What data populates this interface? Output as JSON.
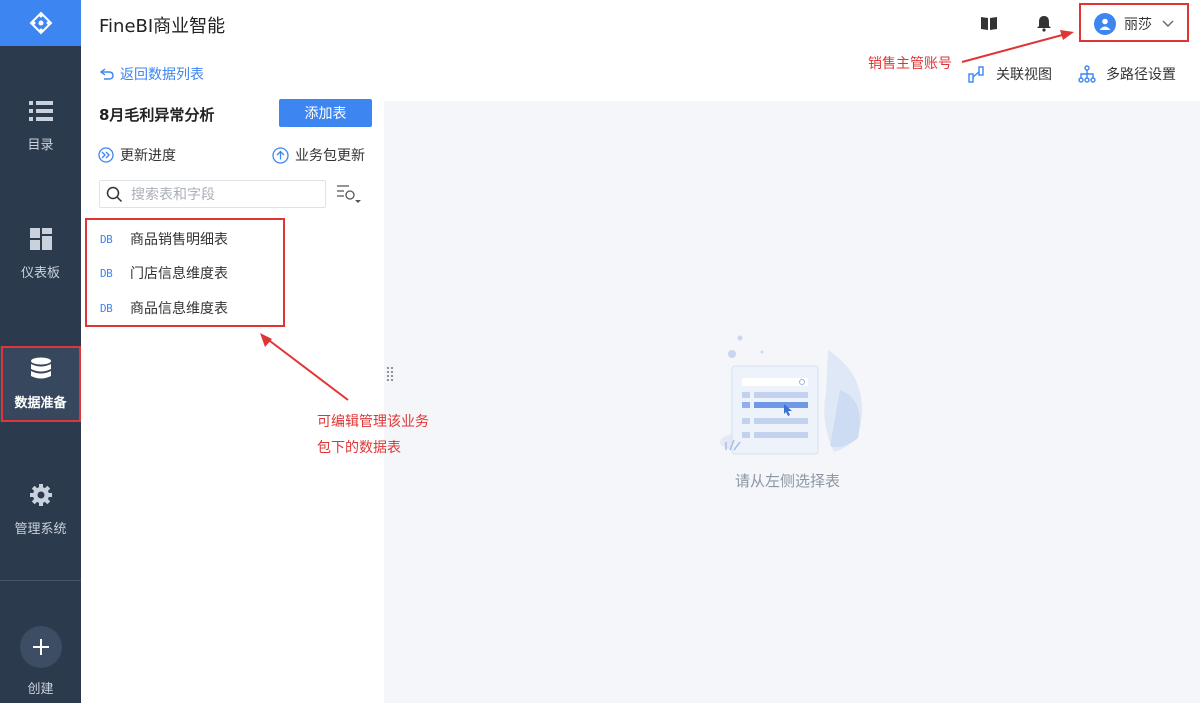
{
  "app": {
    "title": "FineBI商业智能"
  },
  "nav": {
    "items": [
      {
        "label": "目录",
        "icon": "list-icon"
      },
      {
        "label": "仪表板",
        "icon": "dashboard-icon"
      },
      {
        "label": "数据准备",
        "icon": "database-icon",
        "active": true
      },
      {
        "label": "管理系统",
        "icon": "gear-icon"
      },
      {
        "label": "创建",
        "icon": "plus-icon"
      }
    ]
  },
  "header": {
    "user_name": "丽莎"
  },
  "toolbar": {
    "relation_view": "关联视图",
    "multi_path": "多路径设置"
  },
  "panel": {
    "back_label": "返回数据列表",
    "package_name": "8月毛利异常分析",
    "add_table_label": "添加表",
    "update_progress": "更新进度",
    "package_update": "业务包更新",
    "search_placeholder": "搜索表和字段",
    "tables": [
      {
        "badge": "DB",
        "name": "商品销售明细表"
      },
      {
        "badge": "DB",
        "name": "门店信息维度表"
      },
      {
        "badge": "DB",
        "name": "商品信息维度表"
      }
    ]
  },
  "main": {
    "empty_text": "请从左侧选择表"
  },
  "annotations": {
    "account_note": "销售主管账号",
    "tables_note_line1": "可编辑管理该业务",
    "tables_note_line2": "包下的数据表"
  },
  "colors": {
    "accent": "#3d85f0",
    "nav_bg": "#2b3a4d",
    "annotation_red": "#e03535"
  }
}
